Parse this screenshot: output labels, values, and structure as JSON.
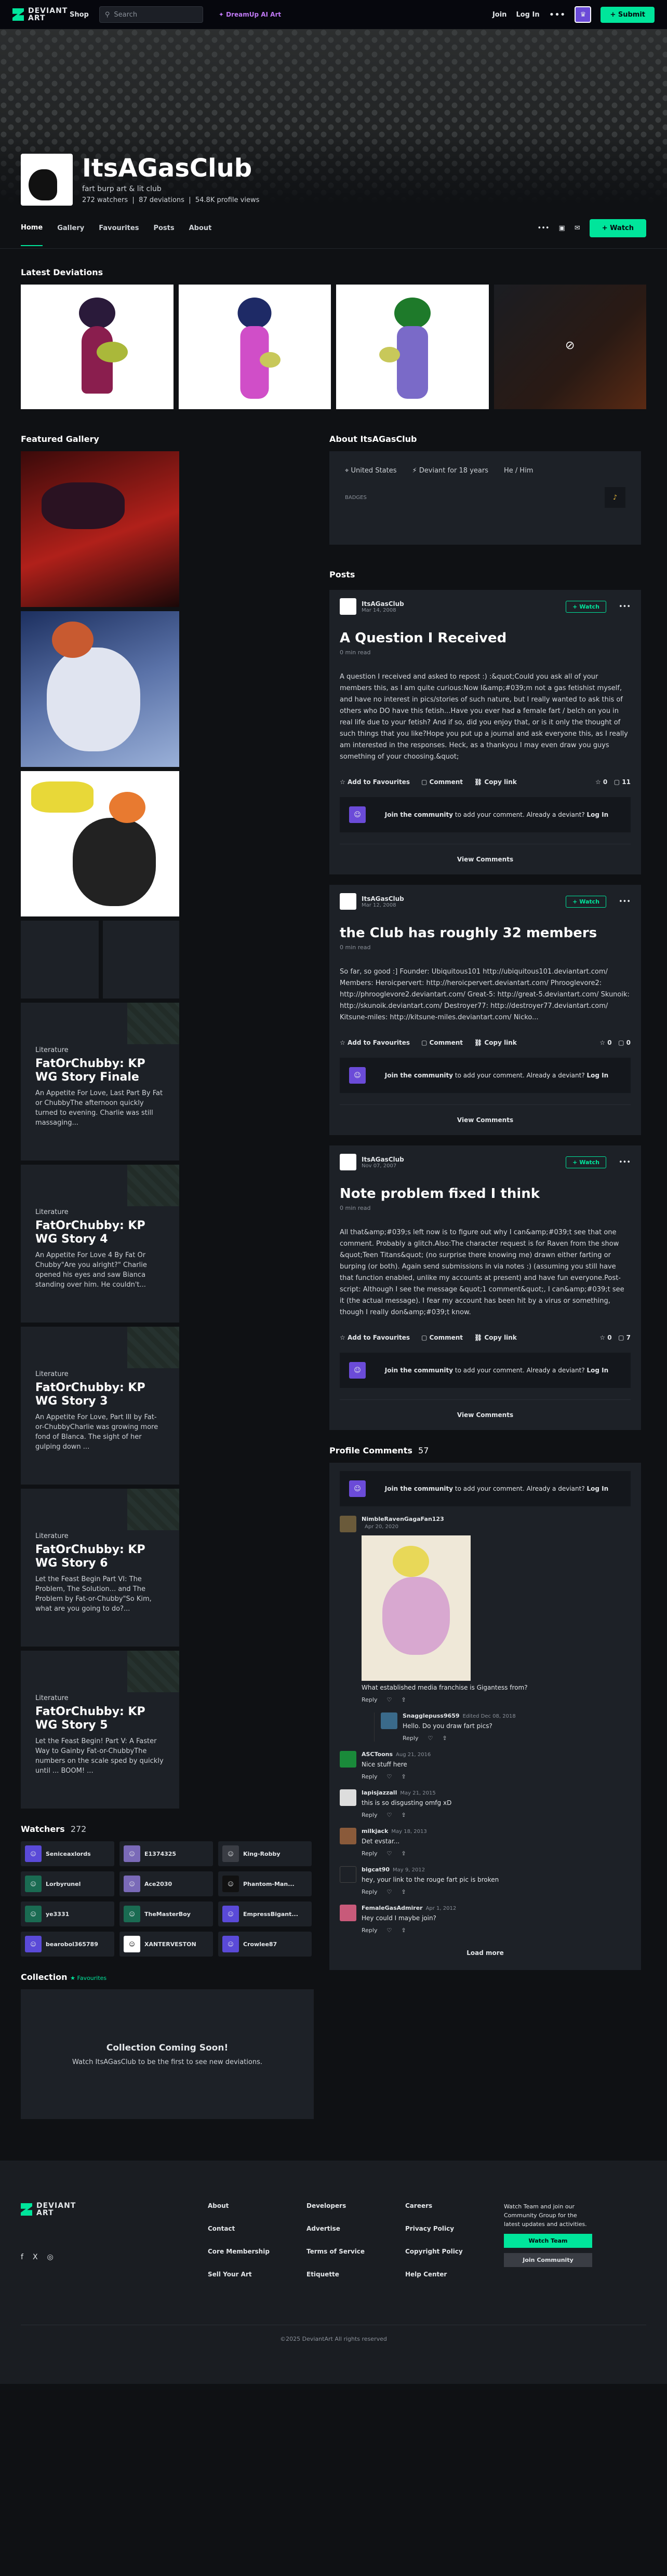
{
  "nav": {
    "logo": "DEVIANT ART",
    "shop": "Shop",
    "search_placeholder": "Search",
    "dream": "DreamUp AI Art",
    "join": "Join",
    "login": "Log In",
    "submit": "Submit"
  },
  "profile": {
    "name": "ItsAGasClub",
    "tagline": "fart burp art & lit club",
    "watchers": "272 watchers",
    "deviations": "87 deviations",
    "views": "54.8K profile views"
  },
  "tabs": [
    "Home",
    "Gallery",
    "Favourites",
    "Posts",
    "About"
  ],
  "tabs_watch": "Watch",
  "latest": {
    "title": "Latest Deviations"
  },
  "featured": {
    "title": "Featured Gallery"
  },
  "literature": [
    {
      "kind": "Literature",
      "title": "FatOrChubby: KP WG Story Finale",
      "excerpt": "An Appetite For Love, Last Part By Fat or ChubbyThe afternoon quickly turned to evening. Charlie was still massaging..."
    },
    {
      "kind": "Literature",
      "title": "FatOrChubby: KP WG Story 4",
      "excerpt": "An Appetite For Love 4 By Fat Or Chubby\"Are you alright?\" Charlie opened his eyes and saw Bianca standing over him. He couldn't..."
    },
    {
      "kind": "Literature",
      "title": "FatOrChubby: KP WG Story 3",
      "excerpt": "An Appetite For Love, Part III by Fat-or-ChubbyCharlie was growing more fond of Blanca. The sight of her gulping down ..."
    },
    {
      "kind": "Literature",
      "title": "FatOrChubby: KP WG Story 6",
      "excerpt": "Let the Feast Begin Part VI: The Problem, The Solution... and The Problem by Fat-or-Chubby\"So Kim, what are you going to do?..."
    },
    {
      "kind": "Literature",
      "title": "FatOrChubby: KP WG Story 5",
      "excerpt": "Let the Feast Begin! Part V: A Faster Way to Gainby Fat-or-ChubbyThe numbers on the scale sped by quickly until ... BOOM! ..."
    }
  ],
  "watchers": {
    "title": "Watchers",
    "count": "272",
    "list": [
      "Seniceaxlords",
      "E1374325",
      "King-Robby",
      "Lorbyrunel",
      "Ace2030",
      "Phantom-Man...",
      "ye3331",
      "TheMasterBoy",
      "EmpressBigant...",
      "bearobol365789",
      "XANTERVESTON",
      "Crowlee87"
    ]
  },
  "collection": {
    "title": "Collection",
    "fav": "Favourites",
    "heading": "Collection Coming Soon!",
    "text": "Watch ItsAGasClub to be the first to see new deviations."
  },
  "about": {
    "title": "About ItsAGasClub",
    "country": "United States",
    "since": "Deviant for 18 years",
    "pronoun": "He / Him",
    "badges": "BADGES"
  },
  "posts": {
    "title": "Posts",
    "items": [
      {
        "user": "ItsAGasClub",
        "date": "Mar 14, 2008",
        "watch": "Watch",
        "title": "A Question I Received",
        "read": "0 min read",
        "body": "A question I received and asked to repost :) :&quot;Could you ask all of your members this, as I am quite curious:Now I&amp;#039;m not a gas fetishist myself, and have no interest in pics/stories of such nature, but I really wanted to ask this of others who DO have this fetish...Have you ever had a female fart / belch on you in real life due to your fetish? And if so, did you enjoy that, or is it only the thought of such things that you like?Hope you put up a journal and ask everyone this, as I really am interested in the responses. Heck, as a thankyou I may even draw you guys something of your choosing.&quot;",
        "fav": "Add to Favourites",
        "comment": "Comment",
        "copy": "Copy link",
        "c": "11"
      },
      {
        "user": "ItsAGasClub",
        "date": "Mar 12, 2008",
        "watch": "Watch",
        "title": "the Club has roughly 32 members",
        "read": "0 min read",
        "body": "So far, so good :] Founder: Ubiquitous101 http://ubiquitous101.deviantart.com/ Members: Heroicpervert: http://heroicpervert.deviantart.com/ Phrooglevore2: http://phrooglevore2.deviantart.com/ Great-5: http://great-5.deviantart.com/ Skunoik: http://skunoik.deviantart.com/ Destroyer77: http://destroyer77.deviantart.com/ Kitsune-miles: http://kitsune-miles.deviantart.com/ Nicko...",
        "fav": "Add to Favourites",
        "comment": "Comment",
        "copy": "Copy link",
        "c": "0"
      },
      {
        "user": "ItsAGasClub",
        "date": "Nov 07, 2007",
        "watch": "Watch",
        "title": "Note problem fixed I think",
        "read": "0 min read",
        "body": "All that&amp;#039;s left now is to figure out why I can&amp;#039;t see that one comment. Probably a glitch.Also:The character request is for Raven from the show &quot;Teen Titans&quot; (no surprise there knowing me) drawn either farting or burping (or both). Again send submissions in via notes :) (assuming you still have that function enabled, unlike my accounts at present) and have fun everyone.Post-script: Although I see the message &quot;1 comment&quot;, I can&amp;#039;t see it (the actual message). I fear my account has been hit by a virus or something, though I really don&amp;#039;t know.",
        "fav": "Add to Favourites",
        "comment": "Comment",
        "copy": "Copy link",
        "c": "7"
      }
    ],
    "join": "Join the community",
    "join_rest": " to add your comment. Already a deviant? ",
    "login": "Log In",
    "view": "View Comments"
  },
  "comments": {
    "title": "Profile Comments",
    "count": "57",
    "list": [
      {
        "user": "NimbleRavenGagaFan123",
        "date": "Apr 20, 2020",
        "text": "What established media franchise is Gigantess from?",
        "reply": "Reply"
      },
      {
        "user": "Snagglepuss9659",
        "date": "Edited Dec 08, 2018",
        "text": "Hello. Do you draw fart pics?",
        "reply": "Reply"
      },
      {
        "user": "ASCToons",
        "date": "Aug 21, 2016",
        "text": "Nice stuff here",
        "reply": "Reply"
      },
      {
        "user": "lapisjazzall",
        "date": "May 21, 2015",
        "text": "this is so disgusting omfg xD",
        "reply": "Reply"
      },
      {
        "user": "milkjack",
        "date": "May 18, 2013",
        "text": "Det evstar...",
        "reply": "Reply"
      },
      {
        "user": "bigcat90",
        "date": "May 9, 2012",
        "text": "hey, your link to the rouge fart pic is broken",
        "reply": "Reply"
      },
      {
        "user": "FemaleGasAdmirer",
        "date": "Apr 1, 2012",
        "text": "Hey could I maybe join?",
        "reply": "Reply"
      }
    ],
    "load": "Load more"
  },
  "footer": {
    "cols": [
      [
        "About",
        "Contact",
        "Core Membership",
        "Sell Your Art"
      ],
      [
        "Developers",
        "Advertise",
        "Terms of Service",
        "Etiquette"
      ],
      [
        "Careers",
        "Privacy Policy",
        "Copyright Policy",
        "Help Center"
      ]
    ],
    "team_text": "Watch  Team and join our Community Group for the latest updates and activities.",
    "watch_team": "Watch Team",
    "join_community": "Join Community",
    "copy": "©2025 DeviantArt    All rights reserved"
  },
  "colors": {
    "accent": "#00e59b",
    "bg": "#0f1114",
    "card": "#1d2127"
  }
}
